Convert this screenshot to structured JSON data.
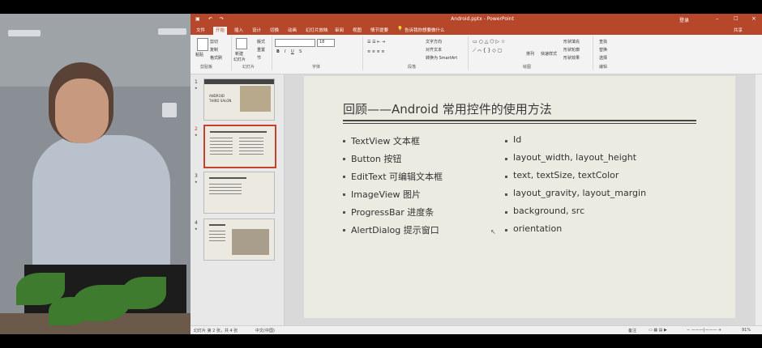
{
  "window": {
    "title": "Android.pptx - PowerPoint",
    "login": "登录",
    "share": "共享"
  },
  "tabs": [
    "文件",
    "开始",
    "插入",
    "设计",
    "切换",
    "动画",
    "幻灯片放映",
    "审阅",
    "视图",
    "情节提要"
  ],
  "tell_me": "告诉我你想要做什么",
  "ribbon": {
    "paste": "粘贴",
    "cut": "剪切",
    "copy": "复制",
    "format_painter": "格式刷",
    "new_slide": "新建",
    "new_slide2": "幻灯片",
    "layout": "版式",
    "reset": "重置",
    "section": "节",
    "text_direction": "文字方向",
    "align_text": "对齐文本",
    "smartart": "转换为 SmartArt",
    "arrange": "排列",
    "quick_styles": "快速样式",
    "shape_fill": "形状填充",
    "shape_outline": "形状轮廓",
    "shape_effects": "形状效果",
    "find": "查找",
    "replace": "替换",
    "select": "选择",
    "groups": {
      "clipboard": "剪贴板",
      "slides": "幻灯片",
      "font": "字体",
      "paragraph": "段落",
      "drawing": "绘图",
      "editing": "编辑"
    },
    "font_size": "18"
  },
  "thumbnails": [
    {
      "num": "1",
      "star": "★",
      "line1": "ANDROID",
      "line2": "THIRD SALON"
    },
    {
      "num": "2",
      "star": "★"
    },
    {
      "num": "3",
      "star": "★"
    },
    {
      "num": "4",
      "star": "★"
    }
  ],
  "slide": {
    "title": "回顾——Android 常用控件的使用方法",
    "left_bullets": [
      "TextView 文本框",
      "Button 按钮",
      "EditText 可编辑文本框",
      "ImageView 图片",
      "ProgressBar 进度条",
      "AlertDialog 提示窗口"
    ],
    "right_bullets": [
      "Id",
      "layout_width, layout_height",
      "text, textSize, textColor",
      "layout_gravity, layout_margin",
      "background, src",
      "orientation"
    ]
  },
  "status": {
    "slide_info": "幻灯片 第 2 张，共 4 张",
    "language": "中文(中国)",
    "notes": "备注",
    "zoom": "91%"
  },
  "colors": {
    "accent": "#b7472a",
    "slide_bg": "#ecebe1"
  }
}
